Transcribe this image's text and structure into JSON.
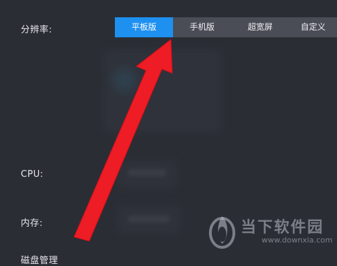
{
  "settings": {
    "resolution_label": "分辨率:",
    "cpu_label": "CPU:",
    "memory_label": "内存:",
    "disk_label": "磁盘管理",
    "resolution_tabs": [
      {
        "label": "平板版",
        "selected": true
      },
      {
        "label": "手机版",
        "selected": false
      },
      {
        "label": "超宽屏",
        "selected": false
      },
      {
        "label": "自定义",
        "selected": false
      }
    ]
  },
  "annotation": {
    "arrow_color": "#ee1c25",
    "arrow_icon": "red-arrow-icon"
  },
  "colors": {
    "background": "#2a2d34",
    "tab_selected": "#1e90f0",
    "tab_bar": "#4a4d56"
  },
  "watermark": {
    "title": "当下软件园",
    "url": "www.downxia.com",
    "logo_icon": "downxia-logo-icon"
  }
}
